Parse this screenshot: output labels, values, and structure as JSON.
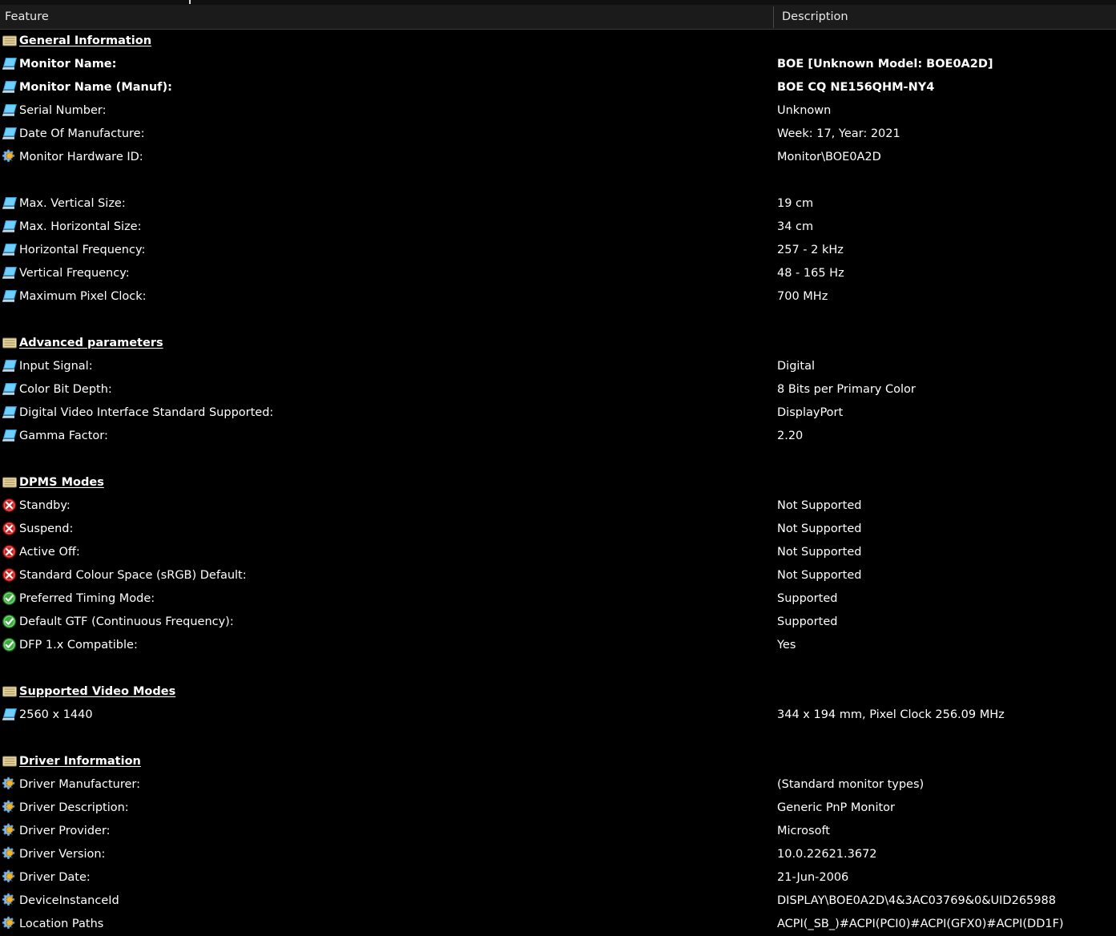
{
  "window": {
    "header": {
      "feature_label": "Feature",
      "description_label": "Description"
    }
  },
  "colors": {
    "background": "#000000",
    "header_bar": "#1b1b1b",
    "text": "#ffffff",
    "divider": "#4a4a4a",
    "icon_monitor_blue": "#2f9fe0",
    "icon_gear_blue": "#7fb8e8",
    "icon_gear_orange": "#f0b429",
    "icon_ledger_tan": "#e8d9a8",
    "icon_error_red": "#cc2020",
    "icon_ok_green": "#3faa3f"
  },
  "rows": [
    {
      "icon": "ledger-icon",
      "style": "section",
      "feature": "General Information",
      "value": ""
    },
    {
      "icon": "monitor-icon",
      "style": "bold",
      "feature": "Monitor Name:",
      "value": "BOE [Unknown Model: BOE0A2D]"
    },
    {
      "icon": "monitor-icon",
      "style": "bold",
      "feature": "Monitor Name (Manuf):",
      "value": "BOE CQ      NE156QHM-NY4"
    },
    {
      "icon": "monitor-icon",
      "style": "normal",
      "feature": "Serial Number:",
      "value": "Unknown"
    },
    {
      "icon": "monitor-icon",
      "style": "normal",
      "feature": "Date Of Manufacture:",
      "value": "Week: 17, Year: 2021"
    },
    {
      "icon": "gear-icon",
      "style": "normal",
      "feature": "Monitor Hardware ID:",
      "value": "Monitor\\BOE0A2D"
    },
    {
      "icon": "none",
      "style": "spacer",
      "feature": "",
      "value": ""
    },
    {
      "icon": "monitor-icon",
      "style": "normal",
      "feature": "Max. Vertical Size:",
      "value": "19 cm"
    },
    {
      "icon": "monitor-icon",
      "style": "normal",
      "feature": "Max. Horizontal Size:",
      "value": "34 cm"
    },
    {
      "icon": "monitor-icon",
      "style": "normal",
      "feature": "Horizontal Frequency:",
      "value": "257 - 2 kHz"
    },
    {
      "icon": "monitor-icon",
      "style": "normal",
      "feature": "Vertical Frequency:",
      "value": "48 - 165 Hz"
    },
    {
      "icon": "monitor-icon",
      "style": "normal",
      "feature": "Maximum Pixel Clock:",
      "value": "700 MHz"
    },
    {
      "icon": "none",
      "style": "spacer",
      "feature": "",
      "value": ""
    },
    {
      "icon": "ledger-icon",
      "style": "section",
      "feature": "Advanced parameters",
      "value": ""
    },
    {
      "icon": "monitor-icon",
      "style": "normal",
      "feature": "Input Signal:",
      "value": "Digital"
    },
    {
      "icon": "monitor-icon",
      "style": "normal",
      "feature": "Color Bit Depth:",
      "value": "8 Bits per Primary Color"
    },
    {
      "icon": "monitor-icon",
      "style": "normal",
      "feature": "Digital Video Interface Standard Supported:",
      "value": "DisplayPort"
    },
    {
      "icon": "monitor-icon",
      "style": "normal",
      "feature": "Gamma Factor:",
      "value": "2.20"
    },
    {
      "icon": "none",
      "style": "spacer",
      "feature": "",
      "value": ""
    },
    {
      "icon": "ledger-icon",
      "style": "section",
      "feature": "DPMS Modes",
      "value": ""
    },
    {
      "icon": "error-icon",
      "style": "normal",
      "feature": "Standby:",
      "value": "Not Supported"
    },
    {
      "icon": "error-icon",
      "style": "normal",
      "feature": "Suspend:",
      "value": "Not Supported"
    },
    {
      "icon": "error-icon",
      "style": "normal",
      "feature": "Active Off:",
      "value": "Not Supported"
    },
    {
      "icon": "error-icon",
      "style": "normal",
      "feature": "Standard Colour Space (sRGB) Default:",
      "value": "Not Supported"
    },
    {
      "icon": "check-icon",
      "style": "normal",
      "feature": "Preferred Timing Mode:",
      "value": "Supported"
    },
    {
      "icon": "check-icon",
      "style": "normal",
      "feature": "Default GTF (Continuous Frequency):",
      "value": "Supported"
    },
    {
      "icon": "check-icon",
      "style": "normal",
      "feature": "DFP 1.x Compatible:",
      "value": "Yes"
    },
    {
      "icon": "none",
      "style": "spacer",
      "feature": "",
      "value": ""
    },
    {
      "icon": "ledger-icon",
      "style": "section",
      "feature": "Supported Video Modes",
      "value": ""
    },
    {
      "icon": "monitor-icon",
      "style": "normal",
      "feature": "2560 x 1440",
      "value": "344 x 194 mm, Pixel Clock 256.09 MHz"
    },
    {
      "icon": "none",
      "style": "spacer",
      "feature": "",
      "value": ""
    },
    {
      "icon": "ledger-icon",
      "style": "section",
      "feature": "Driver Information",
      "value": ""
    },
    {
      "icon": "gear-icon",
      "style": "normal",
      "feature": "Driver Manufacturer:",
      "value": "(Standard monitor types)"
    },
    {
      "icon": "gear-icon",
      "style": "normal",
      "feature": "Driver Description:",
      "value": "Generic PnP Monitor"
    },
    {
      "icon": "gear-icon",
      "style": "normal",
      "feature": "Driver Provider:",
      "value": "Microsoft"
    },
    {
      "icon": "gear-icon",
      "style": "normal",
      "feature": "Driver Version:",
      "value": "10.0.22621.3672"
    },
    {
      "icon": "gear-icon",
      "style": "normal",
      "feature": "Driver Date:",
      "value": "21-Jun-2006"
    },
    {
      "icon": "gear-icon",
      "style": "normal",
      "feature": "DeviceInstanceId",
      "value": "DISPLAY\\BOE0A2D\\4&3AC03769&0&UID265988"
    },
    {
      "icon": "gear-icon",
      "style": "normal",
      "feature": "Location Paths",
      "value": "ACPI(_SB_)#ACPI(PCI0)#ACPI(GFX0)#ACPI(DD1F)"
    }
  ]
}
